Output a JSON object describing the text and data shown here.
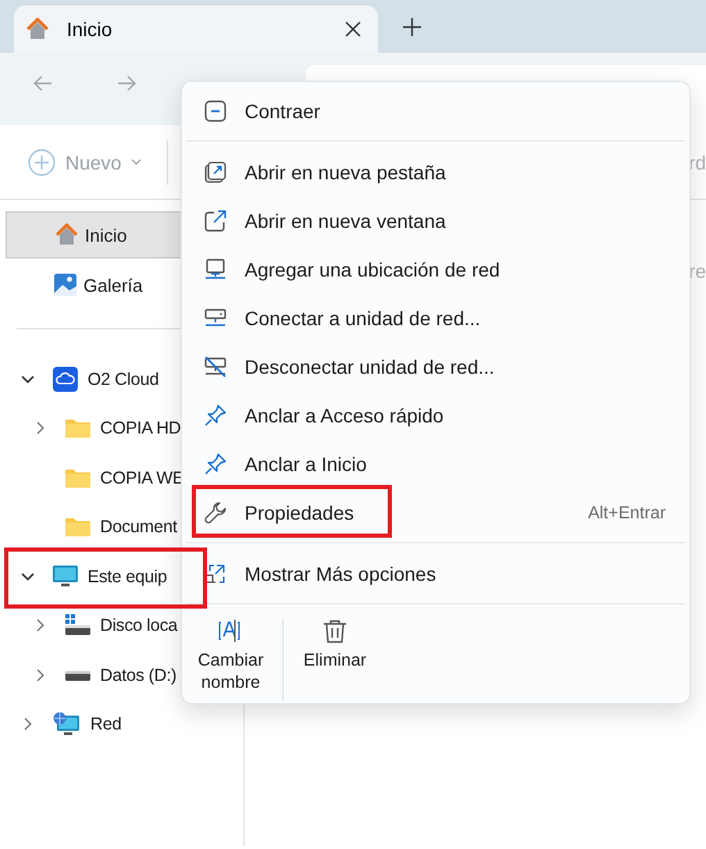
{
  "tab": {
    "title": "Inicio",
    "selected": true
  },
  "toolbar": {
    "new_button": "Nuevo",
    "column_fragment": "rd"
  },
  "content": {
    "fragment": "re"
  },
  "sidebar": {
    "quick": [
      {
        "label": "Inicio",
        "selected": true
      },
      {
        "label": "Galería",
        "selected": false
      }
    ],
    "tree": [
      {
        "label": "O2 Cloud",
        "expanded": true,
        "highlighted": false,
        "children": [
          {
            "label": "COPIA HD",
            "expanded": false,
            "highlighted": false
          },
          {
            "label": "COPIA WE",
            "highlighted": false
          },
          {
            "label": "Document",
            "highlighted": false
          }
        ]
      },
      {
        "label": "Este equip",
        "expanded": true,
        "highlighted": true,
        "children": [
          {
            "label": "Disco loca",
            "expanded": false,
            "highlighted": false
          },
          {
            "label": "Datos (D:)",
            "expanded": false,
            "highlighted": false
          }
        ]
      },
      {
        "label": "Red",
        "expanded": false,
        "highlighted": false
      }
    ]
  },
  "context_menu": {
    "items": [
      {
        "kind": "item",
        "label": "Contraer",
        "highlighted": false
      },
      {
        "kind": "separator"
      },
      {
        "kind": "item",
        "label": "Abrir en nueva pestaña",
        "highlighted": false
      },
      {
        "kind": "item",
        "label": "Abrir en nueva ventana",
        "highlighted": false
      },
      {
        "kind": "item",
        "label": "Agregar una ubicación de red",
        "highlighted": false
      },
      {
        "kind": "item",
        "label": "Conectar a unidad de red...",
        "highlighted": false
      },
      {
        "kind": "item",
        "label": "Desconectar unidad de red...",
        "highlighted": false
      },
      {
        "kind": "item",
        "label": "Anclar a Acceso rápido",
        "highlighted": false
      },
      {
        "kind": "item",
        "label": "Anclar a Inicio",
        "highlighted": false
      },
      {
        "kind": "item",
        "label": "Propiedades",
        "shortcut": "Alt+Entrar",
        "highlighted": true
      },
      {
        "kind": "separator"
      },
      {
        "kind": "item",
        "label": "Mostrar Más opciones",
        "highlighted": false
      },
      {
        "kind": "separator"
      }
    ],
    "actions": [
      {
        "label": "Cambiar nombre"
      },
      {
        "label": "Eliminar"
      }
    ]
  }
}
